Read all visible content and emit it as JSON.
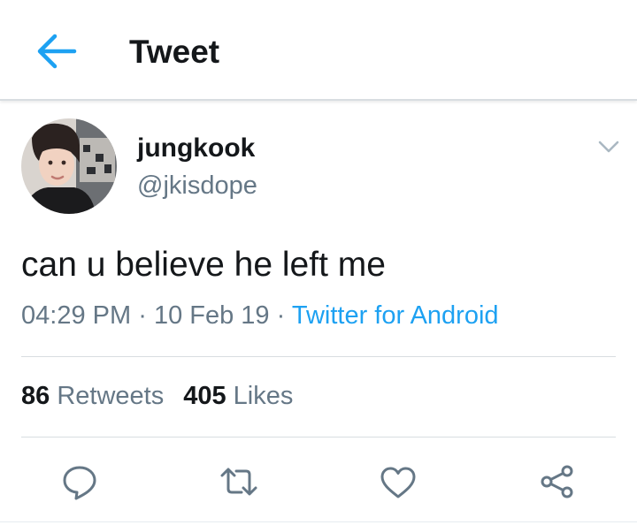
{
  "header": {
    "title": "Tweet",
    "back_icon": "arrow-left-icon"
  },
  "tweet": {
    "author_name": "jungkook",
    "author_handle": "@jkisdope",
    "text": "can u believe he left me",
    "time": "04:29 PM",
    "separator": "·",
    "date": "10 Feb 19",
    "source": "Twitter for Android",
    "retweets_count": "86",
    "retweets_label": "Retweets",
    "likes_count": "405",
    "likes_label": "Likes"
  },
  "actions": [
    "reply-icon",
    "retweet-icon",
    "like-icon",
    "share-icon"
  ],
  "colors": {
    "accent": "#1da1f2",
    "text_primary": "#14171a",
    "text_secondary": "#657786",
    "divider": "#d8dde1"
  }
}
